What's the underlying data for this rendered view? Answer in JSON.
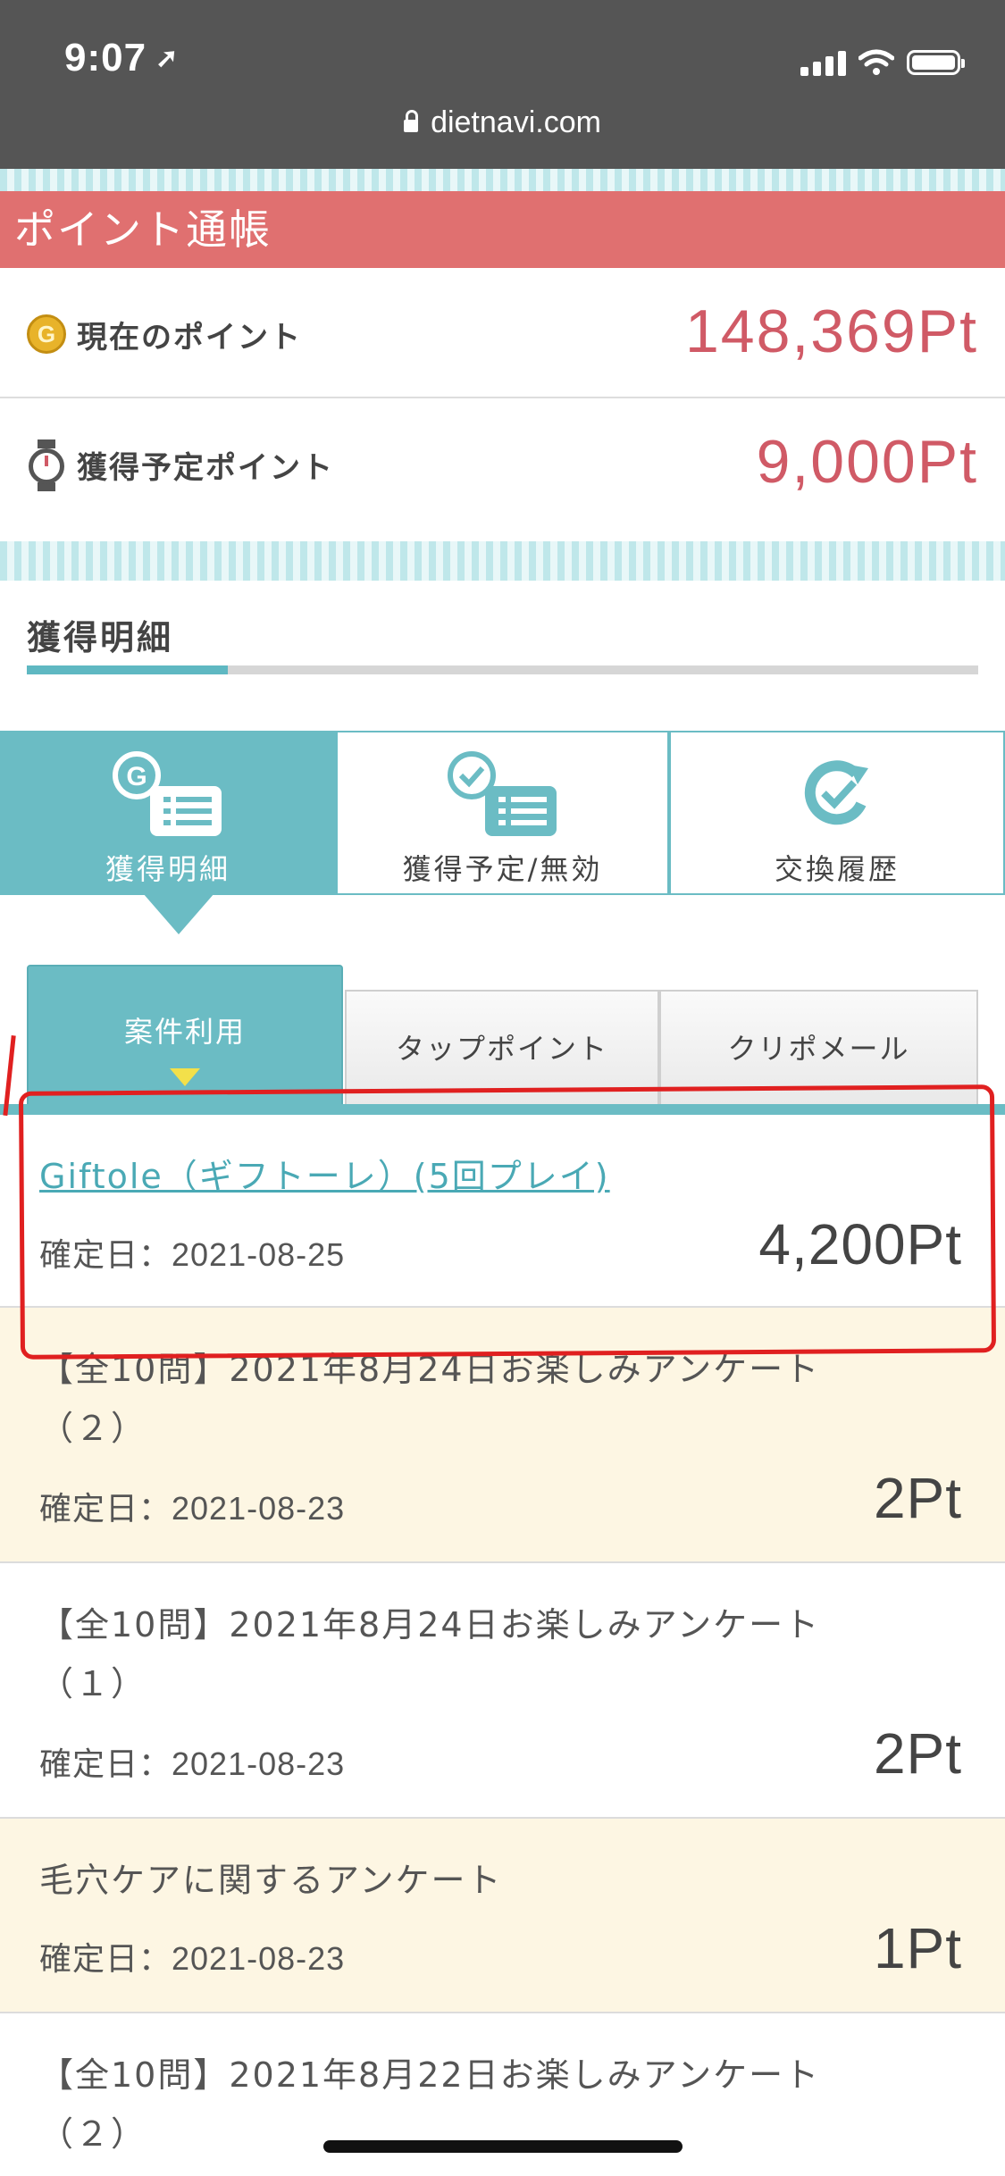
{
  "status_bar": {
    "time": "9:07",
    "url": "dietnavi.com"
  },
  "page_header": {
    "title": "ポイント通帳"
  },
  "points": [
    {
      "label": "現在のポイント",
      "value": "148,369Pt",
      "icon": "coin-icon",
      "icon_letter": "G"
    },
    {
      "label": "獲得予定ポイント",
      "value": "9,000Pt",
      "icon": "watch-icon"
    }
  ],
  "section": {
    "title": "獲得明細",
    "progress": 0.21
  },
  "main_tabs": [
    {
      "label": "獲得明細",
      "icon": "coin-list-icon",
      "active": true
    },
    {
      "label": "獲得予定/無効",
      "icon": "clock-list-icon",
      "active": false
    },
    {
      "label": "交換履歴",
      "icon": "exchange-check-icon",
      "active": false
    }
  ],
  "sub_tabs": [
    {
      "label": "案件利用",
      "active": true
    },
    {
      "label": "タップポイント",
      "active": false
    },
    {
      "label": "クリポメール",
      "active": false
    }
  ],
  "items": [
    {
      "title": "Giftole（ギフトーレ）(5回プレイ)",
      "date": "確定日：2021-08-25",
      "points": "4,200Pt",
      "link": true
    },
    {
      "title": "【全10問】2021年8月24日お楽しみアンケート（２）",
      "date": "確定日：2021-08-23",
      "points": "2Pt",
      "link": false
    },
    {
      "title": "【全10問】2021年8月24日お楽しみアンケート（１）",
      "date": "確定日：2021-08-23",
      "points": "2Pt",
      "link": false
    },
    {
      "title": "毛穴ケアに関するアンケート",
      "date": "確定日：2021-08-23",
      "points": "1Pt",
      "link": false
    },
    {
      "title": "【全10問】2021年8月22日お楽しみアンケート（２）",
      "date": "",
      "points": "",
      "link": false
    }
  ],
  "colors": {
    "accent": "#6bbcc4",
    "header_red": "#e07070",
    "point_red": "#d05a66",
    "highlight_bg": "#fdf6e3",
    "annotation": "#e02020"
  }
}
